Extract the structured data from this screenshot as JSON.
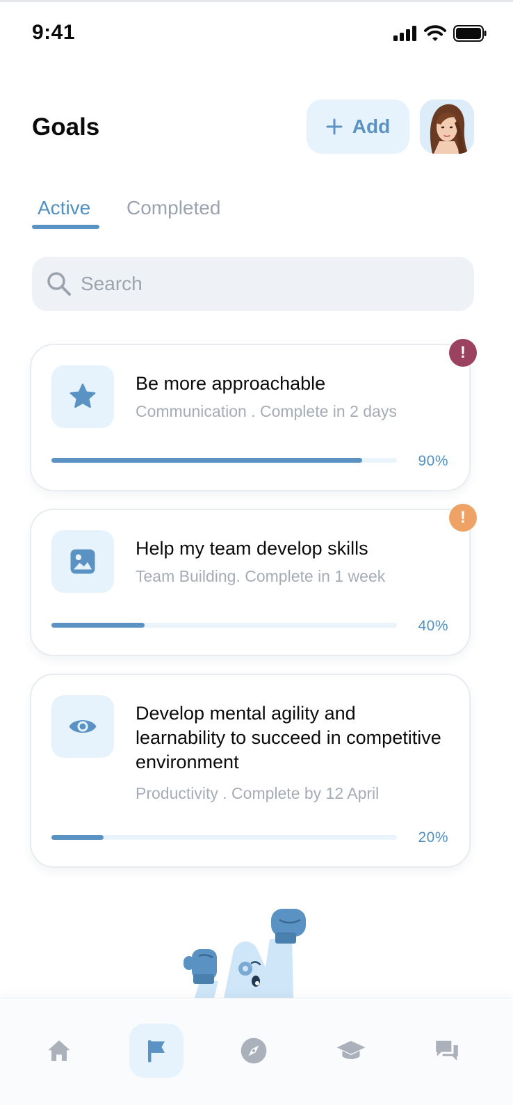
{
  "status_bar": {
    "time": "9:41"
  },
  "header": {
    "title": "Goals",
    "add_label": "Add"
  },
  "tabs": [
    {
      "label": "Active",
      "active": true
    },
    {
      "label": "Completed",
      "active": false
    }
  ],
  "search": {
    "placeholder": "Search",
    "value": ""
  },
  "goals": [
    {
      "title": "Be more approachable",
      "subtitle": "Communication . Complete in 2 days",
      "progress_percent": 90,
      "progress_label": "90%",
      "icon": "star-icon",
      "alert": true,
      "alert_color": "#9b4260"
    },
    {
      "title": "Help my team develop skills",
      "subtitle": "Team Building. Complete in 1 week",
      "progress_percent": 27,
      "progress_label": "40%",
      "icon": "image-icon",
      "alert": true,
      "alert_color": "#eea266"
    },
    {
      "title": "Develop mental agility and learnability to succeed in competitive environment",
      "subtitle": "Productivity . Complete by 12 April",
      "progress_percent": 15,
      "progress_label": "20%",
      "icon": "eye-icon",
      "alert": false
    }
  ],
  "bottom_nav": [
    {
      "icon": "home-icon",
      "active": false
    },
    {
      "icon": "flag-icon",
      "active": true
    },
    {
      "icon": "compass-icon",
      "active": false
    },
    {
      "icon": "graduation-cap-icon",
      "active": false
    },
    {
      "icon": "chat-icon",
      "active": false
    }
  ],
  "colors": {
    "accent": "#5a93c3",
    "accent_light": "#e6f3fc",
    "muted_text": "#a5acb5",
    "alert_high": "#9b4260",
    "alert_medium": "#eea266"
  }
}
